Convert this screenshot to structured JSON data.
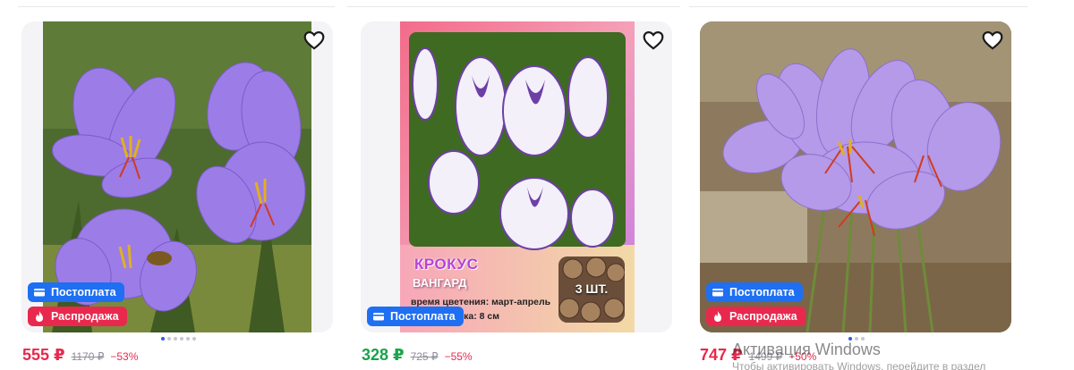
{
  "products": [
    {
      "price": "555 ₽",
      "old_price": "1170 ₽",
      "discount": "−53%",
      "price_color": "#e8294d",
      "badges": [
        "Постоплата",
        "Распродажа"
      ],
      "images_count": 6,
      "image_index": 0,
      "image_alt": "Крокусы"
    },
    {
      "price": "328 ₽",
      "old_price": "725 ₽",
      "discount": "−55%",
      "price_color": "#1aa34a",
      "badges": [
        "Постоплата"
      ],
      "poster": {
        "title": "КРОКУС",
        "subtitle": "ВАНГАРД",
        "line1": "время цветения: март-апрель",
        "line2": "тка: 8 см",
        "qty": "3 ШТ."
      }
    },
    {
      "price": "747 ₽",
      "old_price": "1499 ₽",
      "discount": "−50%",
      "price_color": "#e8294d",
      "badges": [
        "Постоплата",
        "Распродажа"
      ],
      "images_count": 3,
      "image_index": 0
    }
  ],
  "watermark": {
    "title": "Активация Windows",
    "subtitle": "Чтобы активировать Windows, перейдите в раздел"
  },
  "icons": {
    "favorite": "heart-icon",
    "postpay": "card-icon",
    "sale": "fire-icon"
  },
  "colors": {
    "badge_blue": "#1f6ff2",
    "badge_red": "#e8294d",
    "price_sale": "#e8294d",
    "price_green": "#1aa34a"
  }
}
